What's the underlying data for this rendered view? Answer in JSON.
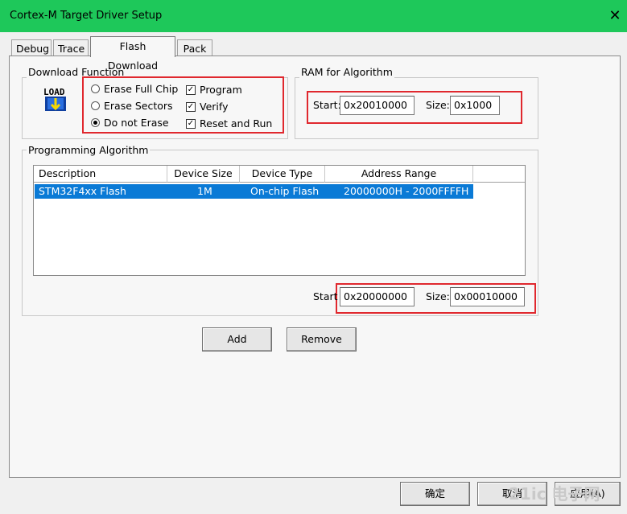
{
  "window": {
    "title": "Cortex-M Target Driver Setup",
    "close_glyph": "✕"
  },
  "tabs": [
    {
      "label": "Debug"
    },
    {
      "label": "Trace"
    },
    {
      "label": "Flash Download"
    },
    {
      "label": "Pack"
    }
  ],
  "download_function": {
    "legend": "Download Function",
    "icon_text": "LOAD",
    "erase_options": [
      {
        "label": "Erase Full Chip",
        "checked": false
      },
      {
        "label": "Erase Sectors",
        "checked": false
      },
      {
        "label": "Do not Erase",
        "checked": true
      }
    ],
    "checks": [
      {
        "label": "Program",
        "checked": true
      },
      {
        "label": "Verify",
        "checked": true
      },
      {
        "label": "Reset and Run",
        "checked": true
      }
    ]
  },
  "ram": {
    "legend": "RAM for Algorithm",
    "start_label": "Start:",
    "start_value": "0x20010000",
    "size_label": "Size:",
    "size_value": "0x1000"
  },
  "programming": {
    "legend": "Programming Algorithm",
    "columns": [
      "Description",
      "Device Size",
      "Device Type",
      "Address Range"
    ],
    "rows": [
      {
        "description": "STM32F4xx Flash",
        "device_size": "1M",
        "device_type": "On-chip Flash",
        "address_range": "20000000H - 2000FFFFH"
      }
    ],
    "start_label": "Start",
    "start_value": "0x20000000",
    "size_label": "Size:",
    "size_value": "0x00010000"
  },
  "buttons": {
    "add": "Add",
    "remove": "Remove",
    "ok": "确定",
    "cancel": "取消",
    "apply": "应用(A)"
  },
  "watermark": "21ic 电子网",
  "colors": {
    "titlebar": "#1ec85a",
    "highlight_box": "#e0282e",
    "selected_row": "#0a7ad6"
  }
}
